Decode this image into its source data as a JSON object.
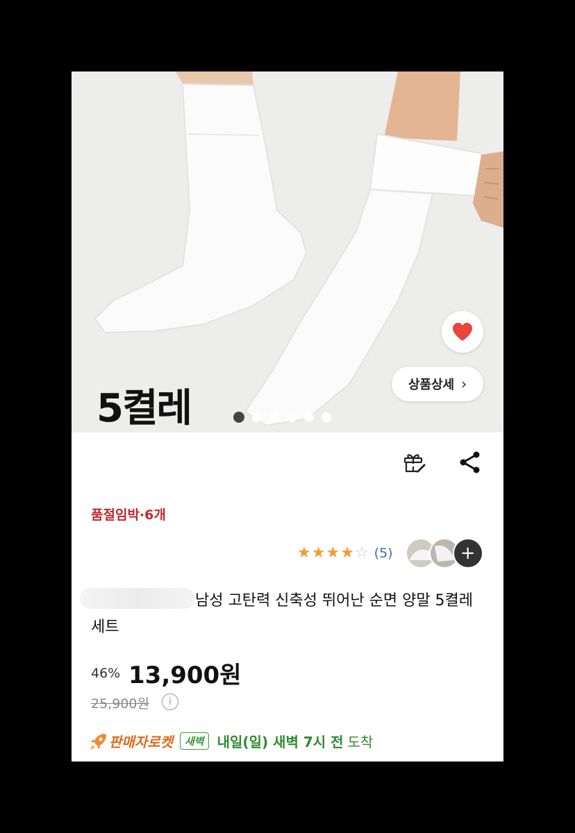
{
  "hero": {
    "caption": "5켤레",
    "detail_button_label": "상품상세",
    "detail_button_chevron": "›",
    "slide_count": 6,
    "active_slide": 1
  },
  "product": {
    "stock_notice": "품절임박·6개",
    "rating": 4,
    "rating_count": "(5)",
    "review_thumb_more": "+",
    "title": "남성 고탄력 신축성 뛰어난 순면 양말 5켤레 세트",
    "discount": "46%",
    "price": "13,900원",
    "original_price": "25,900원",
    "info_symbol": "i"
  },
  "shipping": {
    "rocket_label": "판매자로켓",
    "dawn_badge": "새벽",
    "eta_bold": "내일(일) 새벽 7시 전",
    "eta_rest": "도착"
  },
  "colors": {
    "heart": "#e8453c",
    "stock_red": "#c0282d",
    "star_orange": "#f29b34",
    "rocket_orange": "#e06a1a",
    "dawn_green": "#2e8a2e"
  }
}
